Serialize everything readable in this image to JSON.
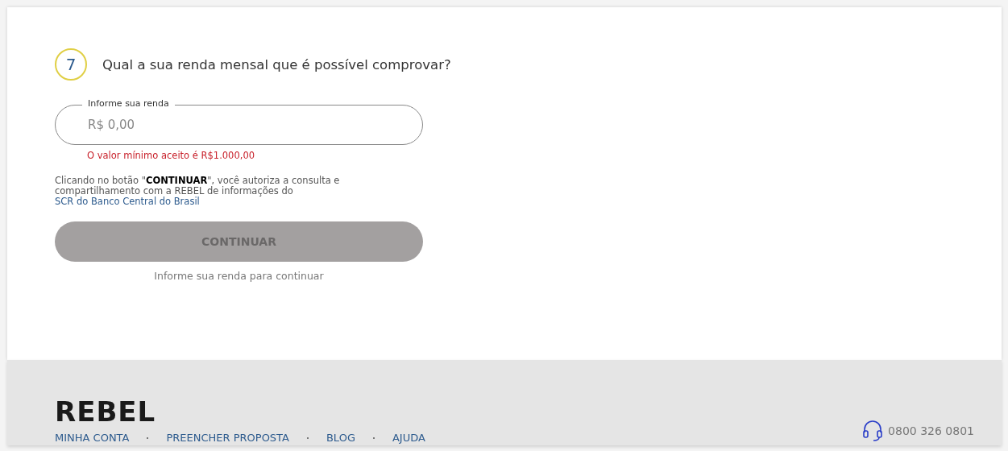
{
  "question": {
    "number": "7",
    "text": "Qual a sua renda mensal que é possível comprovar?"
  },
  "income_field": {
    "label": "Informe sua renda",
    "placeholder": "R$ 0,00",
    "error": "O valor mínimo aceito é R$1.000,00"
  },
  "consent": {
    "text": "Clicando no botão \"**CONTINUAR**\", você autoriza a consulta e compartilhamento com a REBEL de informações do ",
    "link": "SCR do Banco Central do Brasil"
  },
  "continue_button": {
    "label": "CONTINUAR",
    "disabled": true
  },
  "hint": "Informe sua renda para continuar",
  "footer": {
    "logo": "REBEL",
    "links": [
      "MINHA CONTA",
      "PREENCHER PROPOSTA",
      "BLOG",
      "AJUDA"
    ],
    "phone": "0800 326 0801"
  }
}
